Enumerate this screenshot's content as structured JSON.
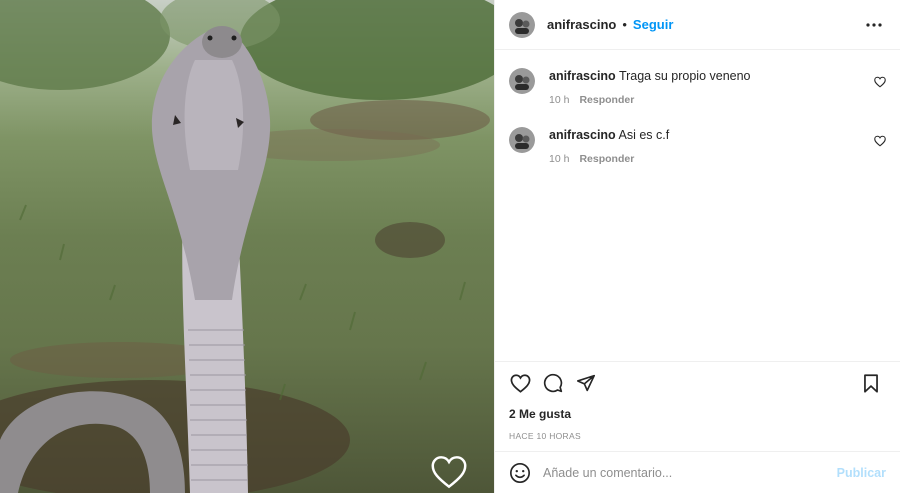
{
  "post": {
    "media": {
      "description_icon": "video-frame-icon",
      "like_overlay_icon": "heart-outline-icon"
    },
    "header": {
      "username": "anifrascino",
      "separator": "•",
      "follow_label": "Seguir",
      "more_icon": "more-options-icon"
    },
    "comments": [
      {
        "username": "anifrascino",
        "text": "Traga su propio veneno",
        "time": "10 h",
        "reply_label": "Responder"
      },
      {
        "username": "anifrascino",
        "text": "Asi es c.f",
        "time": "10 h",
        "reply_label": "Responder"
      }
    ],
    "actions": {
      "icons": [
        "heart-icon",
        "comment-icon",
        "share-icon",
        "bookmark-icon"
      ],
      "likes": "2 Me gusta",
      "time_ago": "HACE 10 HORAS"
    },
    "add_comment": {
      "placeholder": "Añade un comentario...",
      "publish_label": "Publicar",
      "emoji_icon": "emoji-icon"
    },
    "colors": {
      "accent": "#0095f6",
      "publish_disabled": "#b2dffc",
      "secondary_text": "#8e8e8e",
      "divider": "#efefef"
    }
  }
}
